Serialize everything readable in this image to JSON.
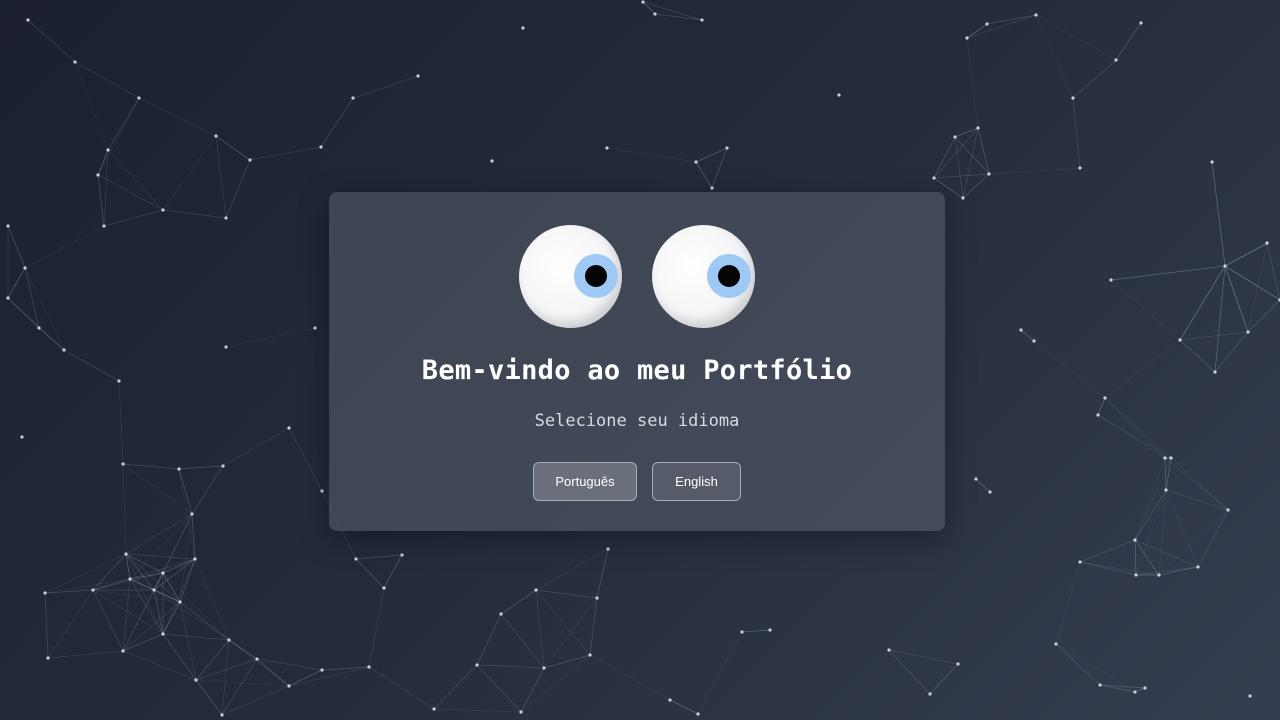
{
  "welcome": {
    "title": "Bem-vindo ao meu Portfólio",
    "subtitle": "Selecione seu idioma"
  },
  "languages": {
    "portuguese_label": "Português",
    "english_label": "English"
  },
  "colors": {
    "background_dark": "#1b2030",
    "background_light": "#353d50",
    "iris": "#9ec9f5",
    "pupil": "#050505",
    "network_line": "#8a94a8",
    "network_dot": "#e6e9ef"
  }
}
